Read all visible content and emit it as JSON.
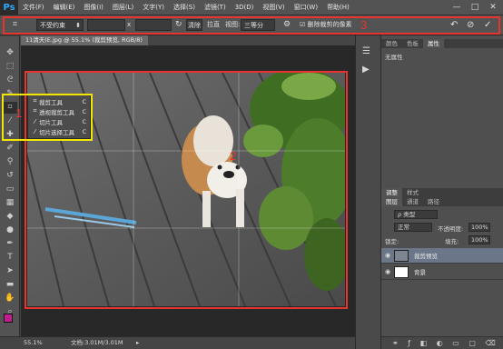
{
  "app": {
    "logo": "Ps"
  },
  "menu": [
    "文件(F)",
    "编辑(E)",
    "图像(I)",
    "图层(L)",
    "文字(Y)",
    "选择(S)",
    "滤镜(T)",
    "3D(D)",
    "视图(V)",
    "窗口(W)",
    "帮助(H)"
  ],
  "window_controls": [
    "—",
    "□",
    "✕"
  ],
  "options_bar": {
    "ratio": "不受约束",
    "ratio_caret": "⬍",
    "sep_x": "x",
    "clear_label": "清除",
    "straighten_label": "拉直",
    "view_label": "视图:",
    "view_value": "三等分",
    "delete_label": "删除裁剪的像素",
    "icons": {
      "reset": "↶",
      "cancel": "⊘",
      "commit": "✓"
    }
  },
  "annotations": {
    "tools": "1",
    "canvas": "2",
    "options": "3"
  },
  "document": {
    "tab": "11清天(E.jpg @ 55.1% (裁剪预览, RGB/8)",
    "zoom": "55.1%",
    "doc_info": "文档:3.01M/3.01M"
  },
  "flyout": [
    {
      "label": "裁剪工具",
      "key": "C",
      "icon": "crop-icon"
    },
    {
      "label": "透视裁剪工具",
      "key": "C",
      "icon": "perspective-crop-icon"
    },
    {
      "label": "切片工具",
      "key": "C",
      "icon": "slice-icon"
    },
    {
      "label": "切片选择工具",
      "key": "C",
      "icon": "slice-select-icon"
    }
  ],
  "panels": {
    "top_tabs": [
      "颜色",
      "色板",
      "属性"
    ],
    "properties_text": "无属性",
    "mid_tabs": [
      "调整",
      "样式"
    ],
    "layer_tabs": [
      "图层",
      "通道",
      "路径"
    ],
    "kind_label": "ρ 类型",
    "blend_mode": "正常",
    "opacity_label": "不透明度:",
    "opacity_value": "100%",
    "lock_label": "锁定:",
    "fill_label": "填充:",
    "fill_value": "100%",
    "layers": [
      {
        "name": "裁剪预览",
        "selected": true
      },
      {
        "name": "背景",
        "selected": false
      }
    ]
  },
  "colors": {
    "annotation_red": "#e8332e",
    "annotation_yellow": "#f3e600",
    "fg_swatch": "#c21c8e",
    "bg_swatch": "#ffffff"
  }
}
